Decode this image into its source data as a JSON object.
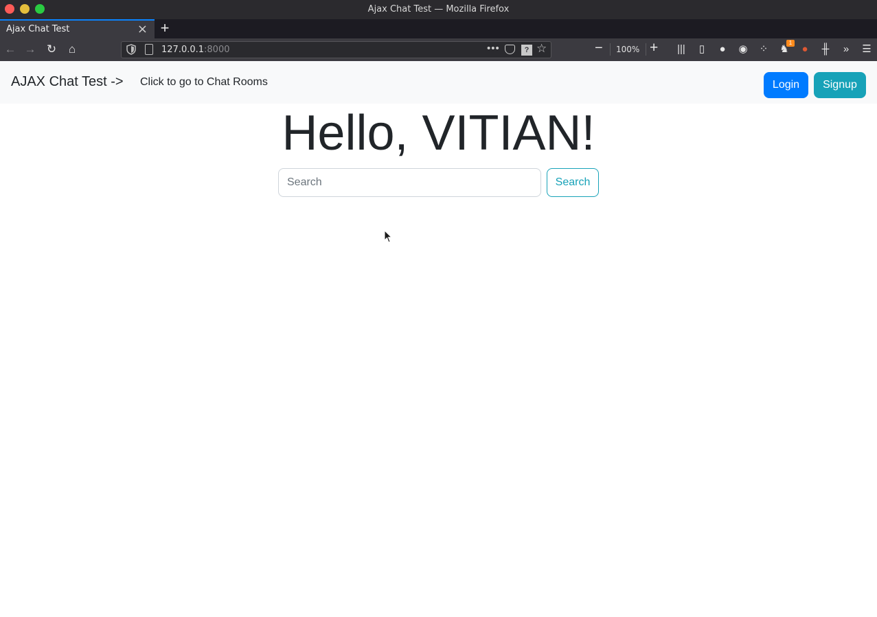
{
  "window": {
    "title": "Ajax Chat Test — Mozilla Firefox"
  },
  "tabs": [
    {
      "label": "Ajax Chat Test",
      "active": true
    }
  ],
  "url": {
    "host": "127.0.0.1",
    "port": ":8000"
  },
  "zoom": {
    "level": "100%"
  },
  "toolbar_icons": [
    "library-icon",
    "sidebar-icon",
    "account-icon",
    "extension-icon",
    "extension-icon",
    "extension-icon",
    "duckduckgo-icon",
    "extension-icon",
    "overflow-icon",
    "menu-icon"
  ],
  "notification_badge": "1",
  "site_nav": {
    "brand": "AJAX Chat Test ->",
    "link": "Click to go to Chat Rooms",
    "login_label": "Login",
    "signup_label": "Signup"
  },
  "main": {
    "greeting": "Hello, VITIAN!",
    "search_placeholder": "Search",
    "search_button": "Search"
  },
  "colors": {
    "primary": "#007bff",
    "info": "#17a2b8",
    "navbar_bg": "#f8f9fa",
    "text": "#212529"
  }
}
